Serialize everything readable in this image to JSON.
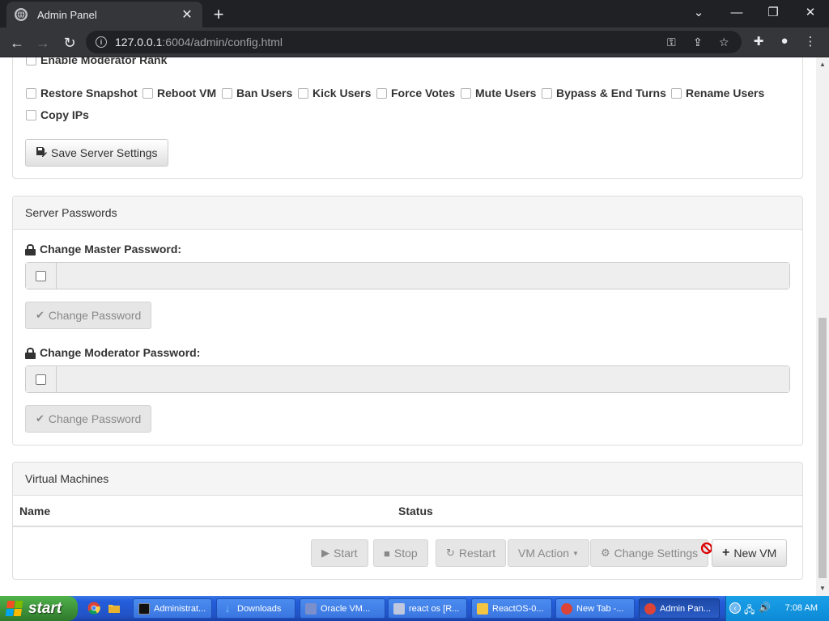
{
  "browser": {
    "tab_title": "Admin Panel",
    "tab_close": "✕",
    "new_tab": "+",
    "url_host": "127.0.0.1",
    "url_path": ":6004/admin/config.html"
  },
  "permissions": {
    "partial_top": "Enable Moderator Rank",
    "items": [
      "Restore Snapshot",
      "Reboot VM",
      "Ban Users",
      "Kick Users",
      "Force Votes",
      "Mute Users",
      "Bypass & End Turns",
      "Rename Users",
      "Copy IPs"
    ],
    "save_button": "Save Server Settings"
  },
  "server_passwords": {
    "heading": "Server Passwords",
    "master_label": "Change Master Password:",
    "moderator_label": "Change Moderator Password:",
    "change_button": "Change Password"
  },
  "virtual_machines": {
    "heading": "Virtual Machines",
    "columns": [
      "Name",
      "Status"
    ],
    "buttons": {
      "start": "Start",
      "stop": "Stop",
      "restart": "Restart",
      "vm_action": "VM Action",
      "change_settings": "Change Settings",
      "new_vm": "New VM"
    }
  },
  "taskbar": {
    "start": "start",
    "tasks": [
      "Administrat...",
      "Downloads",
      "Oracle VM...",
      "react os [R...",
      "ReactOS-0...",
      "New Tab -...",
      "Admin Pan..."
    ],
    "clock": "7:08 AM"
  }
}
